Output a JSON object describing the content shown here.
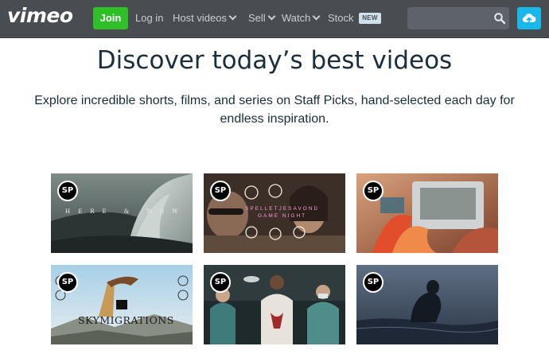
{
  "nav": {
    "logo": "vimeo",
    "join": "Join",
    "login": "Log in",
    "host_videos": "Host videos",
    "sell": "Sell",
    "watch": "Watch",
    "stock": "Stock",
    "stock_badge": "NEW",
    "search_placeholder": "",
    "icons": {
      "search": "search-icon",
      "upload": "upload-cloud-icon",
      "dropdown": "chevron-down-icon"
    }
  },
  "hero": {
    "title": "Discover today’s best videos",
    "subtitle": "Explore incredible shorts, films, and series on Staff Picks, hand-selected each day for endless inspiration."
  },
  "thumbnails": [
    {
      "badge": "SP",
      "overlay": "HERE & NOW"
    },
    {
      "badge": "SP",
      "overlay": "SPELLETJESAVOND\nGAME NIGHT"
    },
    {
      "badge": "SP"
    },
    {
      "badge": "SP",
      "overlay": "SKYMIGRATIONS"
    },
    {
      "badge": "SP"
    },
    {
      "badge": "SP"
    }
  ],
  "colors": {
    "nav_bg": "#494d52",
    "join_green": "#2fbf26",
    "upload_blue": "#1ab7ea",
    "heading": "#1a2e3b"
  }
}
